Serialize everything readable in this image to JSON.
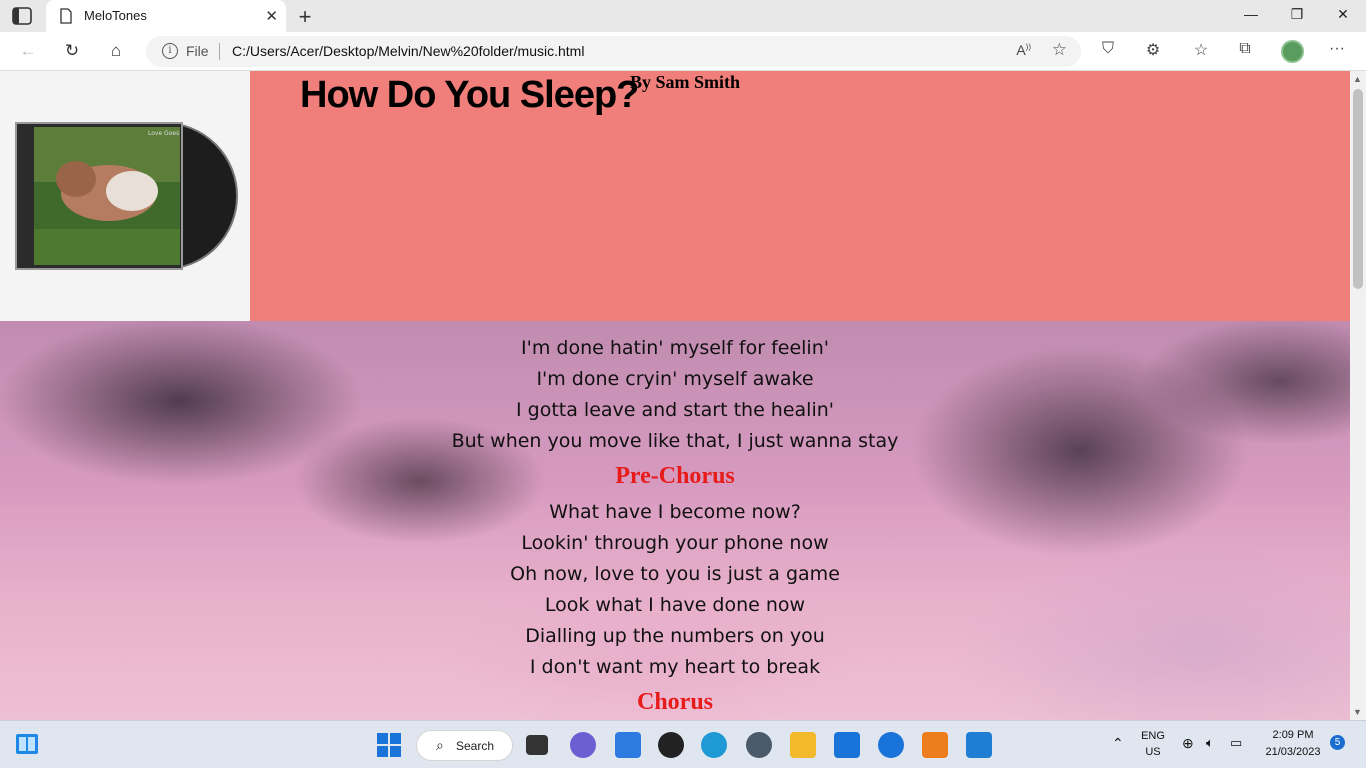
{
  "browser": {
    "tab_title": "MeloTones",
    "address_scheme": "File",
    "address_url": "C:/Users/Acer/Desktop/Melvin/New%20folder/music.html"
  },
  "page": {
    "song_title": "How Do You Sleep?",
    "artist": "By Sam Smith",
    "album_art_text": "Love Goes",
    "lyrics": [
      "I'm done hatin' myself for feelin'",
      "I'm done cryin' myself awake",
      "I gotta leave and start the healin'",
      "But when you move like that, I just wanna stay"
    ],
    "pre_chorus_heading": "Pre-Chorus",
    "pre_chorus": [
      "What have I become now?",
      "Lookin' through your phone now",
      "Oh now, love to you is just a game",
      "Look what I have done now",
      "Dialling up the numbers on you",
      "I don't want my heart to break"
    ],
    "chorus_heading": "Chorus"
  },
  "taskbar": {
    "search_label": "Search",
    "lang_top": "ENG",
    "lang_bottom": "US",
    "time": "2:09 PM",
    "date": "21/03/2023",
    "notification_count": "5"
  },
  "colors": {
    "header_bg": "#f07e7a",
    "heading_red": "#e81b1b"
  }
}
